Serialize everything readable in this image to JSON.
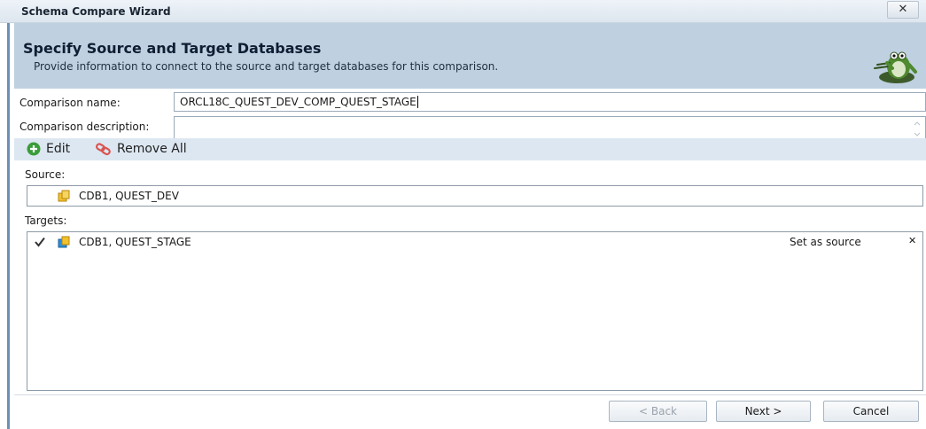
{
  "window": {
    "title": "Schema Compare Wizard",
    "close_glyph": "✕"
  },
  "header": {
    "title": "Specify Source and Target Databases",
    "subtitle": "Provide information to connect to the source and target databases for this comparison.",
    "mascot_icon": "frog-mascot-icon"
  },
  "form": {
    "name_label": "Comparison name:",
    "name_value": "ORCL18C_QUEST_DEV_COMP_QUEST_STAGE",
    "description_label": "Comparison description:",
    "description_value": ""
  },
  "toolbar": {
    "edit_label": "Edit",
    "remove_all_label": "Remove All"
  },
  "source": {
    "label": "Source:",
    "item": "CDB1, QUEST_DEV"
  },
  "targets": {
    "label": "Targets:",
    "items": [
      {
        "checked": true,
        "name": "CDB1, QUEST_STAGE",
        "action": "Set as source",
        "remove_glyph": "✕"
      }
    ]
  },
  "buttons": {
    "back": "< Back",
    "next": "Next >",
    "cancel": "Cancel"
  },
  "colors": {
    "header_bg": "#bfd0e0",
    "toolbar_bg": "#dce7f1",
    "accent": "#6f8fb5"
  }
}
